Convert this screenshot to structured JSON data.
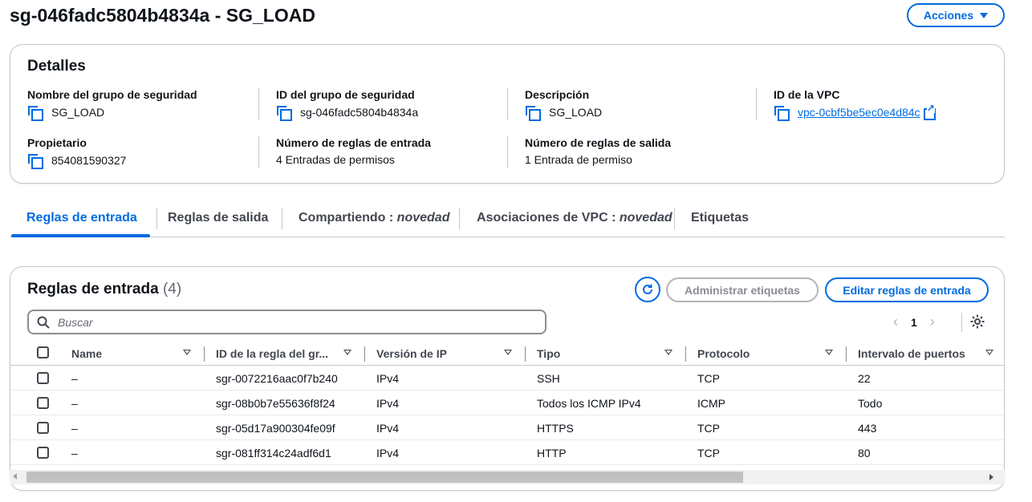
{
  "page": {
    "title": "sg-046fadc5804b4834a - SG_LOAD",
    "actions_label": "Acciones"
  },
  "details": {
    "heading": "Detalles",
    "fields": [
      {
        "label": "Nombre del grupo de seguridad",
        "value": "SG_LOAD"
      },
      {
        "label": "ID del grupo de seguridad",
        "value": "sg-046fadc5804b4834a"
      },
      {
        "label": "Descripción",
        "value": "SG_LOAD"
      },
      {
        "label": "ID de la VPC",
        "value": "vpc-0cbf5be5ec0e4d84c"
      },
      {
        "label": "Propietario",
        "value": "854081590327"
      },
      {
        "label": "Número de reglas de entrada",
        "value": "4 Entradas de permisos"
      },
      {
        "label": "Número de reglas de salida",
        "value": "1 Entrada de permiso"
      }
    ]
  },
  "tabs": [
    {
      "label": "Reglas de entrada",
      "suffix": ""
    },
    {
      "label": "Reglas de salida",
      "suffix": ""
    },
    {
      "label": "Compartiendo : ",
      "suffix": "novedad"
    },
    {
      "label": "Asociaciones de VPC : ",
      "suffix": "novedad"
    },
    {
      "label": "Etiquetas",
      "suffix": ""
    }
  ],
  "rules": {
    "heading": "Reglas de entrada",
    "count": "(4)",
    "manage_tags_label": "Administrar etiquetas",
    "edit_rules_label": "Editar reglas de entrada",
    "search_placeholder": "Buscar",
    "page_number": "1",
    "columns": [
      "Name",
      "ID de la regla del gr...",
      "Versión de IP",
      "Tipo",
      "Protocolo",
      "Intervalo de puertos"
    ],
    "rows": [
      {
        "name": "–",
        "rule_id": "sgr-0072216aac0f7b240",
        "ip_version": "IPv4",
        "type": "SSH",
        "protocol": "TCP",
        "port_range": "22"
      },
      {
        "name": "–",
        "rule_id": "sgr-08b0b7e55636f8f24",
        "ip_version": "IPv4",
        "type": "Todos los ICMP IPv4",
        "protocol": "ICMP",
        "port_range": "Todo"
      },
      {
        "name": "–",
        "rule_id": "sgr-05d17a900304fe09f",
        "ip_version": "IPv4",
        "type": "HTTPS",
        "protocol": "TCP",
        "port_range": "443"
      },
      {
        "name": "–",
        "rule_id": "sgr-081ff314c24adf6d1",
        "ip_version": "IPv4",
        "type": "HTTP",
        "protocol": "TCP",
        "port_range": "80"
      }
    ]
  },
  "icons": {
    "copy": "copy-icon",
    "external": "external-link-icon",
    "refresh": "refresh-icon",
    "search": "search-icon",
    "settings": "gear-icon"
  },
  "colors": {
    "accent": "#006ce0",
    "border": "#c6c6cd",
    "text": "#0f141a",
    "disabled": "#8c8c94"
  }
}
